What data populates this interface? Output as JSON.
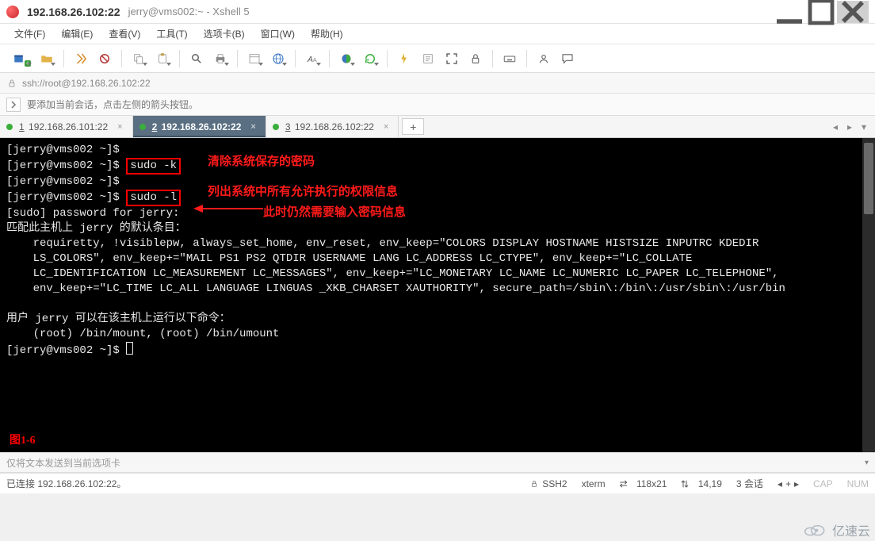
{
  "window": {
    "title_main": "192.168.26.102:22",
    "title_sub": "jerry@vms002:~ - Xshell 5"
  },
  "menu": {
    "file": "文件(F)",
    "edit": "编辑(E)",
    "view": "查看(V)",
    "tools": "工具(T)",
    "tab": "选项卡(B)",
    "window": "窗口(W)",
    "help": "帮助(H)"
  },
  "address": {
    "url": "ssh://root@192.168.26.102:22"
  },
  "tip": {
    "text": "要添加当前会话，点击左侧的箭头按钮。"
  },
  "tabs": {
    "items": [
      {
        "num": "1",
        "label": "192.168.26.101:22",
        "active": false
      },
      {
        "num": "2",
        "label": "192.168.26.102:22",
        "active": true
      },
      {
        "num": "3",
        "label": "192.168.26.102:22",
        "active": false
      }
    ],
    "add": "+"
  },
  "terminal": {
    "prompt1": "[jerry@vms002 ~]$",
    "cmd_k": "sudo -k",
    "prompt2": "[jerry@vms002 ~]$",
    "prompt3": "[jerry@vms002 ~]$",
    "cmd_l": "sudo -l",
    "sudo_pw": "[sudo] password for jerry:",
    "match_line": "匹配此主机上 jerry 的默认条目：",
    "body1": "    requiretty, !visiblepw, always_set_home, env_reset, env_keep=\"COLORS DISPLAY HOSTNAME HISTSIZE INPUTRC KDEDIR",
    "body2": "    LS_COLORS\", env_keep+=\"MAIL PS1 PS2 QTDIR USERNAME LANG LC_ADDRESS LC_CTYPE\", env_keep+=\"LC_COLLATE",
    "body3": "    LC_IDENTIFICATION LC_MEASUREMENT LC_MESSAGES\", env_keep+=\"LC_MONETARY LC_NAME LC_NUMERIC LC_PAPER LC_TELEPHONE\",",
    "body4": "    env_keep+=\"LC_TIME LC_ALL LANGUAGE LINGUAS _XKB_CHARSET XAUTHORITY\", secure_path=/sbin\\:/bin\\:/usr/sbin\\:/usr/bin",
    "run_line": "用户 jerry 可以在该主机上运行以下命令：",
    "cmds_line": "    (root) /bin/mount, (root) /bin/umount",
    "prompt4": "[jerry@vms002 ~]$ "
  },
  "annotations": {
    "a1": "清除系统保存的密码",
    "a2": "列出系统中所有允许执行的权限信息",
    "a3": "此时仍然需要输入密码信息",
    "fig": "图1-6"
  },
  "send_row": {
    "placeholder": "仅将文本发送到当前选项卡"
  },
  "status": {
    "conn": "已连接 192.168.26.102:22。",
    "proto": "SSH2",
    "term": "xterm",
    "size": "118x21",
    "pos": "14,19",
    "sessions": "3 会话",
    "arrows_lr": "⇄",
    "arrows_ud": "↕",
    "cap": "CAP",
    "num": "NUM"
  },
  "brand": {
    "text": "亿速云"
  },
  "colors": {
    "red": "#ff0000",
    "active_tab": "#5a6f82"
  }
}
